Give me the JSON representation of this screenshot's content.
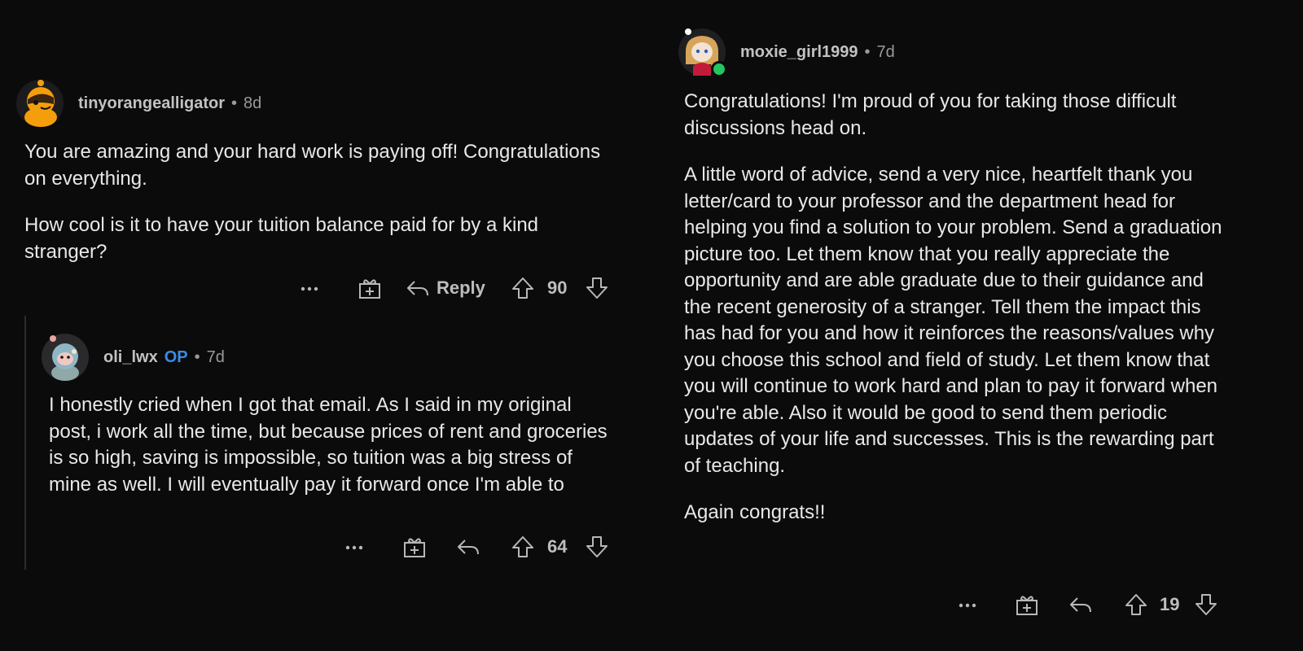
{
  "colors": {
    "background": "#0b0b0c",
    "text": "#e8e8e8",
    "username": "#c2c2c2",
    "meta": "#9a9a9a",
    "op_badge": "#3b8be8",
    "online": "#22c55e"
  },
  "icons": {
    "more": "more-options-icon",
    "award": "award-icon",
    "reply": "reply-icon",
    "upvote": "upvote-icon",
    "downvote": "downvote-icon"
  },
  "left": {
    "comment": {
      "username": "tinyorangealligator",
      "separator": "•",
      "timestamp": "8d",
      "paragraphs": [
        "You are amazing and your hard work is paying off! Congratulations on everything.",
        "How cool is it to have your tuition balance paid for by a kind stranger?"
      ],
      "actions": {
        "more": "•••",
        "reply_label": "Reply",
        "score": "90"
      }
    },
    "reply": {
      "username": "oli_lwx",
      "op_badge": "OP",
      "separator": "•",
      "timestamp": "7d",
      "paragraphs": [
        "I honestly cried when I got that email. As I said in my original post, i work all the time, but because prices of rent and groceries is so high, saving is impossible, so tuition was a big stress of mine as well. I will eventually pay it forward once I'm able to"
      ],
      "actions": {
        "more": "•••",
        "score": "64"
      }
    }
  },
  "right": {
    "comment": {
      "username": "moxie_girl1999",
      "separator": "•",
      "timestamp": "7d",
      "paragraphs": [
        "Congratulations! I'm proud of you for taking those difficult discussions head on.",
        "A little word of advice, send a very nice, heartfelt thank you letter/card to your professor and the department head for helping you find a solution to your problem.  Send a graduation picture too. Let them know that you really appreciate the opportunity and are able graduate due to their guidance and the recent generosity of a stranger.  Tell them the impact this has had for you and how it reinforces the reasons/values why you choose this school and field of study. Let them know that you will continue to work hard and plan to pay it forward when you're able. Also it would be good to send them periodic updates of your life and successes. This is the rewarding part of teaching.",
        "Again congrats!!"
      ],
      "actions": {
        "more": "•••",
        "score": "19"
      }
    }
  }
}
